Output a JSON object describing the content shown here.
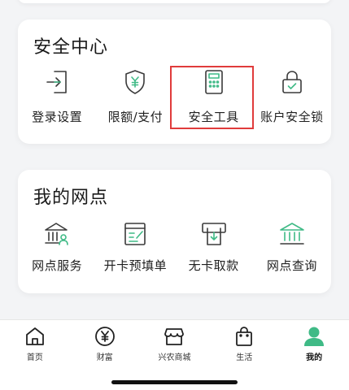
{
  "security_center": {
    "title": "安全中心",
    "items": [
      {
        "label": "登录设置",
        "icon": "login-icon"
      },
      {
        "label": "限额/支付",
        "icon": "shield-yuan-icon"
      },
      {
        "label": "安全工具",
        "icon": "security-token-icon",
        "highlighted": true
      },
      {
        "label": "账户安全锁",
        "icon": "lock-icon"
      }
    ]
  },
  "my_branch": {
    "title": "我的网点",
    "items": [
      {
        "label": "网点服务",
        "icon": "bank-service-icon"
      },
      {
        "label": "开卡预填单",
        "icon": "form-edit-icon"
      },
      {
        "label": "无卡取款",
        "icon": "atm-withdraw-icon"
      },
      {
        "label": "网点查询",
        "icon": "bank-search-icon"
      }
    ]
  },
  "tabbar": {
    "items": [
      {
        "label": "首页",
        "icon": "home-icon"
      },
      {
        "label": "财富",
        "icon": "wealth-yuan-icon"
      },
      {
        "label": "兴农商城",
        "icon": "store-icon"
      },
      {
        "label": "生活",
        "icon": "shopping-bag-icon"
      },
      {
        "label": "我的",
        "icon": "user-icon",
        "active": true
      }
    ]
  },
  "colors": {
    "accent": "#3fba86",
    "icon_stroke": "#3a3a3a",
    "highlight_border": "#e03b3b",
    "background": "#f3f4f6"
  }
}
